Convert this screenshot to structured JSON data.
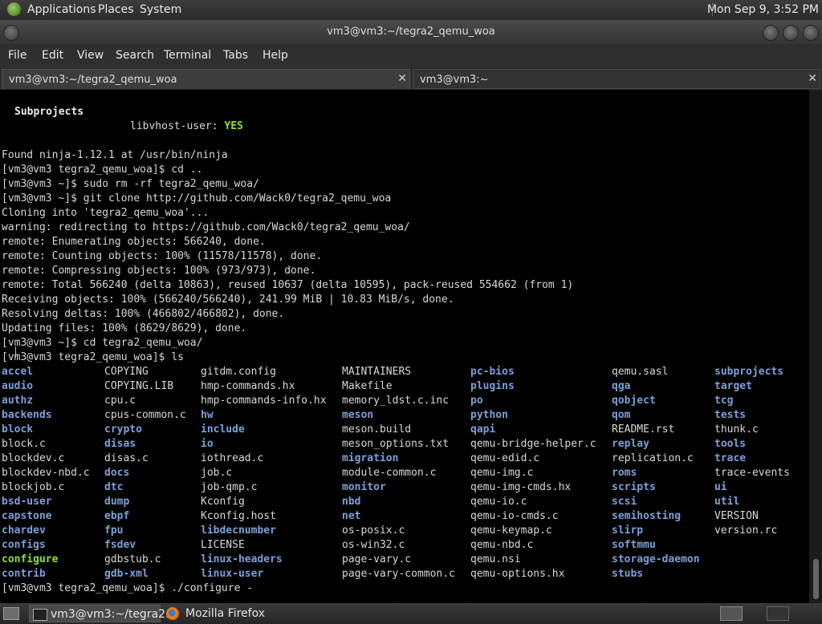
{
  "panel": {
    "menus": [
      "Applications",
      "Places",
      "System"
    ],
    "clock": "Mon Sep  9,  3:52 PM"
  },
  "window": {
    "title": "vm3@vm3:~/tegra2_qemu_woa"
  },
  "menubar": [
    "File",
    "Edit",
    "View",
    "Search",
    "Terminal",
    "Tabs",
    "Help"
  ],
  "tabs": [
    {
      "label": "vm3@vm3:~/tegra2_qemu_woa",
      "close": "✕"
    },
    {
      "label": "vm3@vm3:~",
      "close": "✕"
    }
  ],
  "terminal": {
    "subprojects_header": "Subprojects",
    "libvhost_label": "libvhost-user: ",
    "libvhost_value": "YES",
    "lines": [
      "Found ninja-1.12.1 at /usr/bin/ninja",
      "[vm3@vm3 tegra2_qemu_woa]$ cd ..",
      "[vm3@vm3 ~]$ sudo rm -rf tegra2_qemu_woa/",
      "[vm3@vm3 ~]$ git clone http://github.com/Wack0/tegra2_qemu_woa",
      "Cloning into 'tegra2_qemu_woa'...",
      "warning: redirecting to https://github.com/Wack0/tegra2_qemu_woa/",
      "remote: Enumerating objects: 566240, done.",
      "remote: Counting objects: 100% (11578/11578), done.",
      "remote: Compressing objects: 100% (973/973), done.",
      "remote: Total 566240 (delta 10863), reused 10637 (delta 10595), pack-reused 554662 (from 1)",
      "Receiving objects: 100% (566240/566240), 241.99 MiB | 10.83 MiB/s, done.",
      "Resolving deltas: 100% (466802/466802), done.",
      "Updating files: 100% (8629/8629), done.",
      "[vm3@vm3 ~]$ cd tegra2_qemu_woa/",
      "[vm3@vm3 tegra2_qemu_woa]$ ls"
    ],
    "ls_rows": [
      [
        [
          "accel",
          "d"
        ],
        [
          "COPYING",
          "p"
        ],
        [
          "gitdm.config",
          "p"
        ],
        [
          "MAINTAINERS",
          "p"
        ],
        [
          "pc-bios",
          "d"
        ],
        [
          "qemu.sasl",
          "p"
        ],
        [
          "subprojects",
          "d"
        ]
      ],
      [
        [
          "audio",
          "d"
        ],
        [
          "COPYING.LIB",
          "p"
        ],
        [
          "hmp-commands.hx",
          "p"
        ],
        [
          "Makefile",
          "p"
        ],
        [
          "plugins",
          "d"
        ],
        [
          "qga",
          "d"
        ],
        [
          "target",
          "d"
        ]
      ],
      [
        [
          "authz",
          "d"
        ],
        [
          "cpu.c",
          "p"
        ],
        [
          "hmp-commands-info.hx",
          "p"
        ],
        [
          "memory_ldst.c.inc",
          "p"
        ],
        [
          "po",
          "d"
        ],
        [
          "qobject",
          "d"
        ],
        [
          "tcg",
          "d"
        ]
      ],
      [
        [
          "backends",
          "d"
        ],
        [
          "cpus-common.c",
          "p"
        ],
        [
          "hw",
          "d"
        ],
        [
          "meson",
          "d"
        ],
        [
          "python",
          "d"
        ],
        [
          "qom",
          "d"
        ],
        [
          "tests",
          "d"
        ]
      ],
      [
        [
          "block",
          "d"
        ],
        [
          "crypto",
          "d"
        ],
        [
          "include",
          "d"
        ],
        [
          "meson.build",
          "p"
        ],
        [
          "qapi",
          "d"
        ],
        [
          "README.rst",
          "p"
        ],
        [
          "thunk.c",
          "p"
        ]
      ],
      [
        [
          "block.c",
          "p"
        ],
        [
          "disas",
          "d"
        ],
        [
          "io",
          "d"
        ],
        [
          "meson_options.txt",
          "p"
        ],
        [
          "qemu-bridge-helper.c",
          "p"
        ],
        [
          "replay",
          "d"
        ],
        [
          "tools",
          "d"
        ]
      ],
      [
        [
          "blockdev.c",
          "p"
        ],
        [
          "disas.c",
          "p"
        ],
        [
          "iothread.c",
          "p"
        ],
        [
          "migration",
          "d"
        ],
        [
          "qemu-edid.c",
          "p"
        ],
        [
          "replication.c",
          "p"
        ],
        [
          "trace",
          "d"
        ]
      ],
      [
        [
          "blockdev-nbd.c",
          "p"
        ],
        [
          "docs",
          "d"
        ],
        [
          "job.c",
          "p"
        ],
        [
          "module-common.c",
          "p"
        ],
        [
          "qemu-img.c",
          "p"
        ],
        [
          "roms",
          "d"
        ],
        [
          "trace-events",
          "p"
        ]
      ],
      [
        [
          "blockjob.c",
          "p"
        ],
        [
          "dtc",
          "d"
        ],
        [
          "job-qmp.c",
          "p"
        ],
        [
          "monitor",
          "d"
        ],
        [
          "qemu-img-cmds.hx",
          "p"
        ],
        [
          "scripts",
          "d"
        ],
        [
          "ui",
          "d"
        ]
      ],
      [
        [
          "bsd-user",
          "d"
        ],
        [
          "dump",
          "d"
        ],
        [
          "Kconfig",
          "p"
        ],
        [
          "nbd",
          "d"
        ],
        [
          "qemu-io.c",
          "p"
        ],
        [
          "scsi",
          "d"
        ],
        [
          "util",
          "d"
        ]
      ],
      [
        [
          "capstone",
          "d"
        ],
        [
          "ebpf",
          "d"
        ],
        [
          "Kconfig.host",
          "p"
        ],
        [
          "net",
          "d"
        ],
        [
          "qemu-io-cmds.c",
          "p"
        ],
        [
          "semihosting",
          "d"
        ],
        [
          "VERSION",
          "p"
        ]
      ],
      [
        [
          "chardev",
          "d"
        ],
        [
          "fpu",
          "d"
        ],
        [
          "libdecnumber",
          "d"
        ],
        [
          "os-posix.c",
          "p"
        ],
        [
          "qemu-keymap.c",
          "p"
        ],
        [
          "slirp",
          "d"
        ],
        [
          "version.rc",
          "p"
        ]
      ],
      [
        [
          "configs",
          "d"
        ],
        [
          "fsdev",
          "d"
        ],
        [
          "LICENSE",
          "p"
        ],
        [
          "os-win32.c",
          "p"
        ],
        [
          "qemu-nbd.c",
          "p"
        ],
        [
          "softmmu",
          "d"
        ],
        [
          "",
          ""
        ]
      ],
      [
        [
          "configure",
          "e"
        ],
        [
          "gdbstub.c",
          "p"
        ],
        [
          "linux-headers",
          "d"
        ],
        [
          "page-vary.c",
          "p"
        ],
        [
          "qemu.nsi",
          "p"
        ],
        [
          "storage-daemon",
          "d"
        ],
        [
          "",
          ""
        ]
      ],
      [
        [
          "contrib",
          "d"
        ],
        [
          "gdb-xml",
          "d"
        ],
        [
          "linux-user",
          "d"
        ],
        [
          "page-vary-common.c",
          "p"
        ],
        [
          "qemu-options.hx",
          "p"
        ],
        [
          "stubs",
          "d"
        ],
        [
          "",
          ""
        ]
      ]
    ],
    "last_line": "[vm3@vm3 tegra2_qemu_woa]$ ./configure -"
  },
  "taskbar": {
    "tasks": [
      "vm3@vm3:~/tegra2...",
      "Mozilla Firefox"
    ]
  }
}
